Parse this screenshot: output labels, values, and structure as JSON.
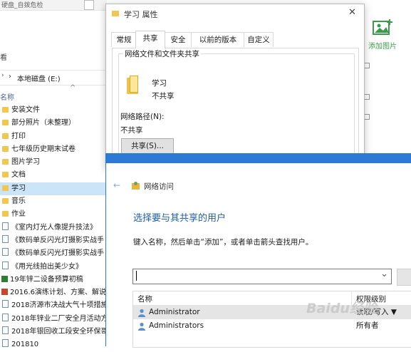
{
  "explorer": {
    "top_title": "硬盘_自拨危检",
    "pane_label": "看",
    "address": "本地磁盘 (E:)",
    "column_name": "名称",
    "files": [
      {
        "name": "安装文件",
        "kind": "folder"
      },
      {
        "name": "部分照片（未整理）",
        "kind": "folder"
      },
      {
        "name": "打印",
        "kind": "folder"
      },
      {
        "name": "七年级历史期末试卷",
        "kind": "folder"
      },
      {
        "name": "图片学习",
        "kind": "folder"
      },
      {
        "name": "文档",
        "kind": "folder"
      },
      {
        "name": "学习",
        "kind": "folder",
        "selected": true
      },
      {
        "name": "音乐",
        "kind": "folder"
      },
      {
        "name": "作业",
        "kind": "folder"
      },
      {
        "name": "《室内灯光人像提升技法》",
        "kind": "doc"
      },
      {
        "name": "《数码单反闪光灯摄影实战手",
        "kind": "doc"
      },
      {
        "name": "《数码单反闪光灯摄影实战手",
        "kind": "doc"
      },
      {
        "name": "《用光线拍出美少女》",
        "kind": "doc"
      },
      {
        "name": "19年锌二设备预算初稿",
        "kind": "xls"
      },
      {
        "name": "2016.6演练计划、方案、解说",
        "kind": "ppt"
      },
      {
        "name": "2018济源市决战大气十项措施",
        "kind": "doc"
      },
      {
        "name": "2018年锌业二厂安全月活动方",
        "kind": "doc"
      },
      {
        "name": "2018年银回收工段安全环保哥",
        "kind": "doc"
      },
      {
        "name": "201810",
        "kind": "doc"
      }
    ],
    "ribbon_add_picture": "添加图片"
  },
  "properties": {
    "title": "学习 属性",
    "close": "✕",
    "tabs": [
      "常规",
      "共享",
      "安全",
      "以前的版本",
      "自定义"
    ],
    "active_tab": 1,
    "group_title": "网络文件和文件夹共享",
    "folder_name": "学习",
    "share_state": "不共享",
    "path_label": "网络路径(N):",
    "path_value": "不共享",
    "share_button": "共享(S)..."
  },
  "network": {
    "back_arrow": "←",
    "title": "网络访问",
    "heading": "选择要与其共享的用户",
    "instruction": "键入名称，然后单击“添加”，或者单击箭头查找用户。",
    "input_value": "",
    "dropdown_arrow": "⌄",
    "table_headers": [
      "名称",
      "权限级别"
    ],
    "rows": [
      {
        "name": "Administrator",
        "permission": "读取/写入 ▼",
        "selected": true
      },
      {
        "name": "Administrators",
        "permission": "所有者",
        "selected": false
      }
    ]
  },
  "watermark": "Baidu经验",
  "colors": {
    "accent": "#2b7bd6",
    "selection": "#cce4f7",
    "heading": "#1f5fa8"
  }
}
